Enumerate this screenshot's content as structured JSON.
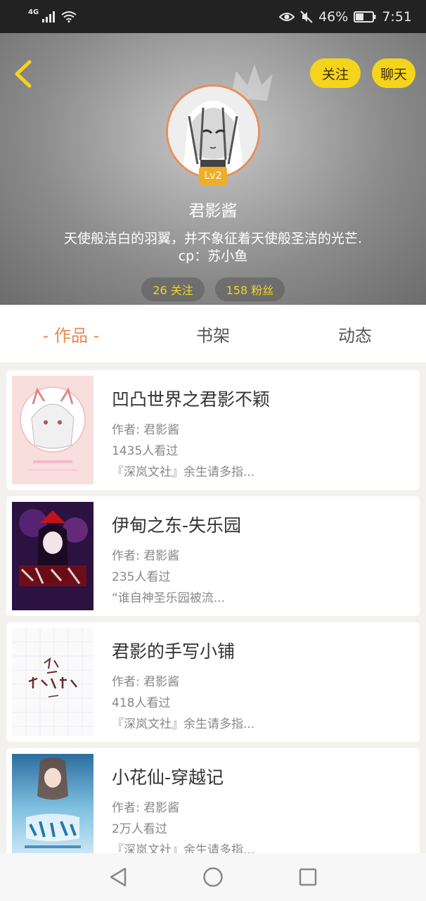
{
  "status_bar": {
    "network": "4G",
    "battery": "46%",
    "time": "7:51"
  },
  "profile": {
    "follow_label": "关注",
    "chat_label": "聊天",
    "level": "Lv2",
    "username": "君影酱",
    "bio_line1": "天使般洁白的羽翼，并不象征着天使般圣洁的光芒.",
    "bio_line2": "cp：苏小鱼",
    "following": "26 关注",
    "followers": "158 粉丝"
  },
  "tabs": [
    {
      "label": "- 作品 -"
    },
    {
      "label": "书架"
    },
    {
      "label": "动态"
    }
  ],
  "works": [
    {
      "title": "凹凸世界之君影不颖",
      "author": "作者: 君影酱",
      "views": "1435人看过",
      "desc": "『深岚文社』余生请多指..."
    },
    {
      "title": "伊甸之东-失乐园",
      "author": "作者: 君影酱",
      "views": "235人看过",
      "desc": "“谁自神圣乐园被流..."
    },
    {
      "title": "君影的手写小铺",
      "author": "作者: 君影酱",
      "views": "418人看过",
      "desc": "『深岚文社』余生请多指..."
    },
    {
      "title": "小花仙-穿越记",
      "author": "作者: 君影酱",
      "views": "2万人看过",
      "desc": "『深岚文社』余生请多指..."
    }
  ],
  "colors": {
    "accent": "#e8894f",
    "pill": "#f5d41c",
    "level_badge": "#f0ae28"
  }
}
